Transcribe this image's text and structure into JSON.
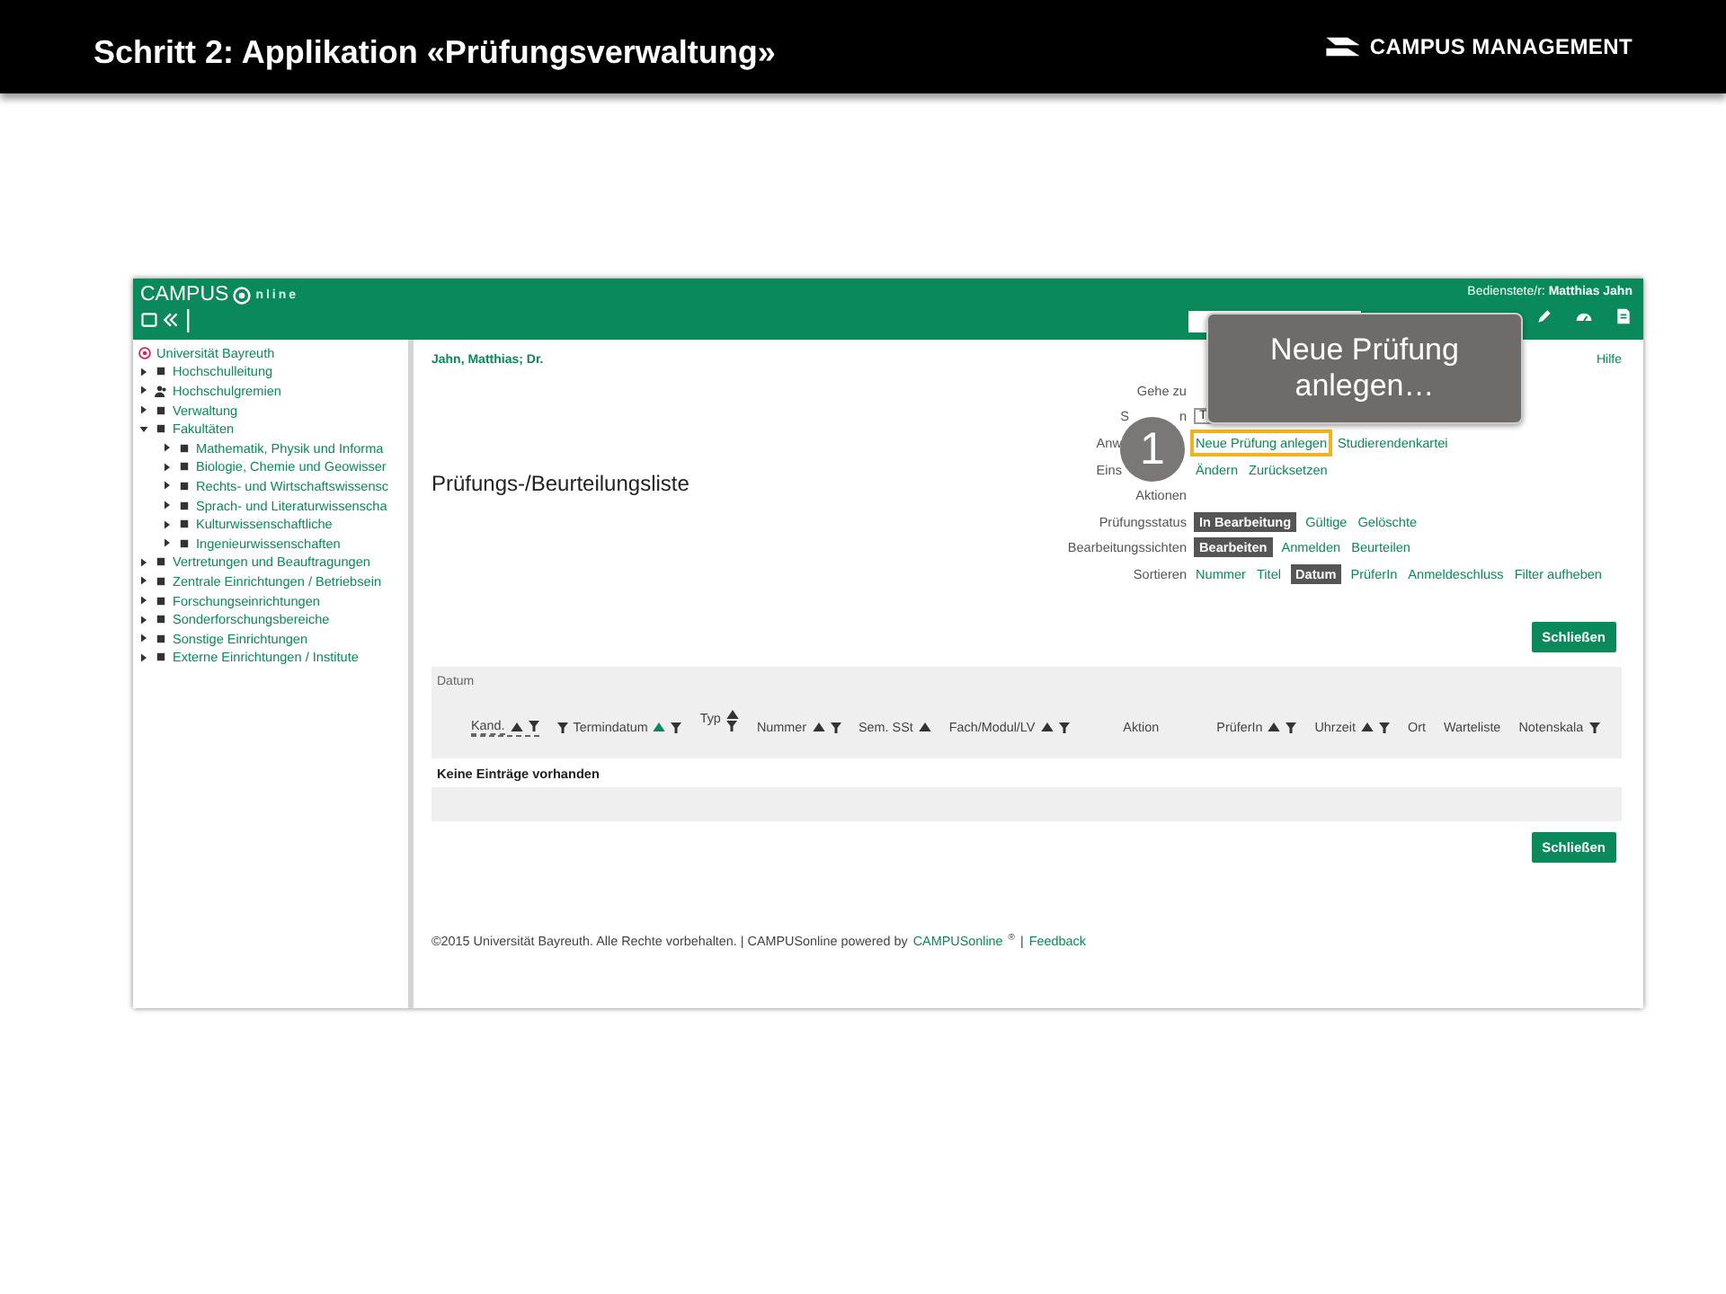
{
  "slide": {
    "title": "Schritt 2: Applikation «Prüfungsverwaltung»",
    "logo": "CAMPUS MANAGEMENT"
  },
  "app": {
    "logo_left": "CAMPUS",
    "logo_right": "nline",
    "user_label": "Bedienstete/r:",
    "user_name": "Matthias Jahn"
  },
  "tree": {
    "root": "Universität Bayreuth",
    "items": [
      {
        "label": "Hochschulleitung",
        "kind": "square",
        "expanded": false
      },
      {
        "label": "Hochschulgremien",
        "kind": "person",
        "expanded": false
      },
      {
        "label": "Verwaltung",
        "kind": "square",
        "expanded": false
      },
      {
        "label": "Fakultäten",
        "kind": "square",
        "expanded": true,
        "children": [
          {
            "label": "Mathematik, Physik und Informa",
            "kind": "square",
            "expanded": false
          },
          {
            "label": "Biologie, Chemie und Geowisser",
            "kind": "square",
            "expanded": false
          },
          {
            "label": "Rechts- und Wirtschaftswissensc",
            "kind": "square",
            "expanded": false
          },
          {
            "label": "Sprach- und Literaturwissenscha",
            "kind": "square",
            "expanded": false
          },
          {
            "label": "Kulturwissenschaftliche",
            "kind": "square",
            "expanded": false
          },
          {
            "label": "Ingenieurwissenschaften",
            "kind": "square",
            "expanded": false
          }
        ]
      },
      {
        "label": "Vertretungen und Beauftragungen",
        "kind": "square",
        "expanded": false
      },
      {
        "label": "Zentrale Einrichtungen / Betriebsein",
        "kind": "square",
        "expanded": false
      },
      {
        "label": "Forschungseinrichtungen",
        "kind": "square",
        "expanded": false
      },
      {
        "label": "Sonderforschungsbereiche",
        "kind": "square",
        "expanded": false
      },
      {
        "label": "Sonstige Einrichtungen",
        "kind": "square",
        "expanded": false
      },
      {
        "label": "Externe Einrichtungen / Institute",
        "kind": "square",
        "expanded": false
      }
    ]
  },
  "person": "Jahn, Matthias; Dr.",
  "help": "Hilfe",
  "page_title": "Prüfungs-/Beurteilungsliste",
  "form": [
    {
      "label": [
        "Gehe zu"
      ],
      "kind": "plain"
    },
    {
      "label": [
        "S",
        "n"
      ],
      "kind": "partial",
      "input": "T"
    },
    {
      "label": [
        "Anw"
      ],
      "kind": "covered",
      "items": [
        {
          "text": "Neue Prüfung anlegen",
          "selected": false,
          "highlighted": true
        },
        {
          "text": "Studierendenkartei",
          "selected": false,
          "highlighted": false
        }
      ]
    },
    {
      "label": [
        "Eins"
      ],
      "kind": "covered",
      "items": [
        {
          "text": "Ändern",
          "selected": false,
          "highlighted": false
        },
        {
          "text": "Zurücksetzen",
          "selected": false,
          "highlighted": false
        }
      ]
    },
    {
      "label": [
        "Aktionen"
      ],
      "kind": "plain"
    },
    {
      "label": [
        "Prüfungsstatus"
      ],
      "kind": "plain",
      "items": [
        {
          "text": "In Bearbeitung",
          "selected": true,
          "highlighted": false
        },
        {
          "text": "Gültige",
          "selected": false,
          "highlighted": false
        },
        {
          "text": "Gelöschte",
          "selected": false,
          "highlighted": false
        }
      ]
    },
    {
      "label": [
        "Bearbeitungssichten"
      ],
      "kind": "plain",
      "items": [
        {
          "text": "Bearbeiten",
          "selected": true,
          "highlighted": false
        },
        {
          "text": "Anmelden",
          "selected": false,
          "highlighted": false
        },
        {
          "text": "Beurteilen",
          "selected": false,
          "highlighted": false
        }
      ]
    },
    {
      "label": [
        "Sortieren"
      ],
      "kind": "plain",
      "items": [
        {
          "text": "Nummer",
          "selected": false,
          "highlighted": false
        },
        {
          "text": "Titel",
          "selected": false,
          "highlighted": false
        },
        {
          "text": "Datum",
          "selected": true,
          "highlighted": false
        },
        {
          "text": "PrüferIn",
          "selected": false,
          "highlighted": false
        },
        {
          "text": "Anmeldeschluss",
          "selected": false,
          "highlighted": false
        },
        {
          "text": "Filter aufheben",
          "selected": false,
          "highlighted": false
        }
      ]
    }
  ],
  "close_button_top": "Schließen",
  "close_button_bottom": "Schließen",
  "table": {
    "group": "Datum",
    "columns": [
      {
        "label": "Kand.",
        "kind": "abbr",
        "sort": true,
        "sort_active": false,
        "filter": true,
        "filter_before": false
      },
      {
        "label": "Termindatum",
        "kind": "plain",
        "sort": true,
        "sort_active": true,
        "filter": true,
        "filter_before": true
      },
      {
        "label": "Typ",
        "kind": "stacked",
        "sort": true,
        "sort_active": false,
        "filter": true,
        "filter_before": false
      },
      {
        "label": "Nummer",
        "kind": "plain",
        "sort": true,
        "sort_active": false,
        "filter": true,
        "filter_before": false
      },
      {
        "label": "Sem. SSt",
        "kind": "plain",
        "sort": true,
        "sort_active": false,
        "filter": false,
        "filter_before": false
      },
      {
        "label": "Fach/Modul/LV",
        "kind": "plain",
        "sort": true,
        "sort_active": false,
        "filter": true,
        "filter_before": false
      },
      {
        "label": "Aktion",
        "kind": "wide",
        "sort": false,
        "filter": false,
        "filter_before": false
      },
      {
        "label": "PrüferIn",
        "kind": "plain",
        "sort": true,
        "sort_active": false,
        "filter": true,
        "filter_before": false
      },
      {
        "label": "Uhrzeit",
        "kind": "plain",
        "sort": true,
        "sort_active": false,
        "filter": true,
        "filter_before": false
      },
      {
        "label": "Ort",
        "kind": "plain",
        "sort": false,
        "filter": false,
        "filter_before": false
      },
      {
        "label": "Warteliste",
        "kind": "plain",
        "sort": false,
        "filter": false,
        "filter_before": false
      },
      {
        "label": "Notenskala",
        "kind": "plain",
        "sort": false,
        "filter": true,
        "filter_before": false
      }
    ],
    "empty": "Keine Einträge vorhanden"
  },
  "footer": {
    "text": "©2015 Universität Bayreuth. Alle Rechte vorbehalten. | CAMPUSonline powered by",
    "link": "CAMPUSonline",
    "mark": "®",
    "sep": "|",
    "feedback": "Feedback"
  },
  "callout": {
    "number": "1",
    "text": "Neue Prüfung anlegen…"
  }
}
